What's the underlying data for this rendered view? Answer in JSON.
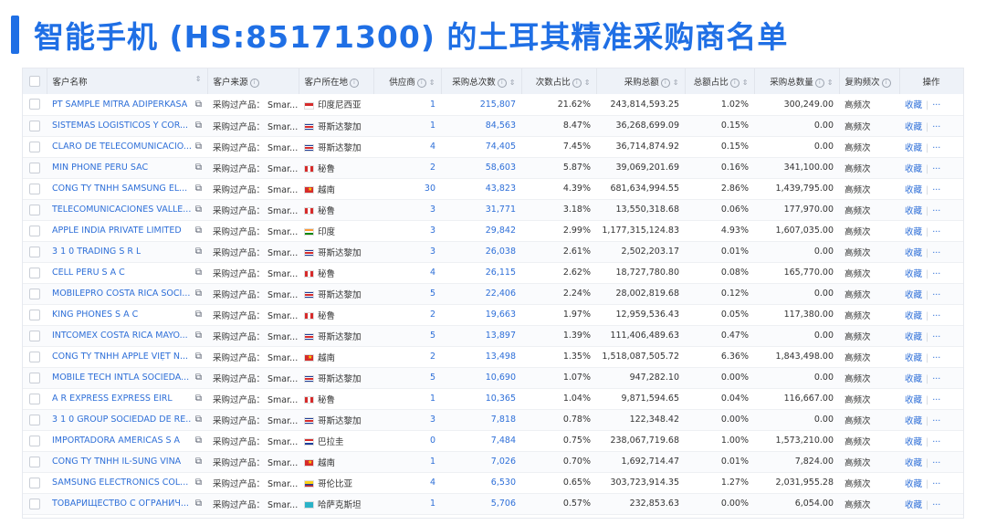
{
  "title": "智能手机 (HS:85171300) 的土耳其精准采购商名单",
  "columns": {
    "name": "客户名称",
    "source": "客户来源",
    "location": "客户所在地",
    "suppliers": "供应商",
    "purchase_count": "采购总次数",
    "count_share": "次数占比",
    "purchase_amount": "采购总额",
    "amount_share": "总额占比",
    "purchase_qty": "采购总数量",
    "repeat_freq": "复购频次",
    "actions": "操作"
  },
  "row_action_label": "收藏",
  "row_more_label": "···",
  "rows": [
    {
      "name": "PT SAMPLE MITRA ADIPERKASA",
      "source": "采购过产品： Smar...",
      "country": "印度尼西亚",
      "flag": "id",
      "suppliers": "1",
      "count": "215,807",
      "count_share": "21.62%",
      "amount": "243,814,593.25",
      "amount_share": "1.02%",
      "qty": "300,249.00",
      "freq": "高频次"
    },
    {
      "name": "SISTEMAS LOGISTICOS Y COR...",
      "source": "采购过产品： Smar...",
      "country": "哥斯达黎加",
      "flag": "cr",
      "suppliers": "1",
      "count": "84,563",
      "count_share": "8.47%",
      "amount": "36,268,699.09",
      "amount_share": "0.15%",
      "qty": "0.00",
      "freq": "高频次"
    },
    {
      "name": "CLARO DE TELECOMUNICACIO...",
      "source": "采购过产品： Smar...",
      "country": "哥斯达黎加",
      "flag": "cr",
      "suppliers": "4",
      "count": "74,405",
      "count_share": "7.45%",
      "amount": "36,714,874.92",
      "amount_share": "0.15%",
      "qty": "0.00",
      "freq": "高频次"
    },
    {
      "name": "MIN PHONE PERU SAC",
      "source": "采购过产品： Smar...",
      "country": "秘鲁",
      "flag": "pe",
      "suppliers": "2",
      "count": "58,603",
      "count_share": "5.87%",
      "amount": "39,069,201.69",
      "amount_share": "0.16%",
      "qty": "341,100.00",
      "freq": "高频次"
    },
    {
      "name": "CÔNG TY TNHH SAMSUNG EL...",
      "source": "采购过产品： Smar...",
      "country": "越南",
      "flag": "vn",
      "suppliers": "30",
      "count": "43,823",
      "count_share": "4.39%",
      "amount": "681,634,994.55",
      "amount_share": "2.86%",
      "qty": "1,439,795.00",
      "freq": "高频次"
    },
    {
      "name": "TELECOMUNICACIONES VALLE...",
      "source": "采购过产品： Smar...",
      "country": "秘鲁",
      "flag": "pe",
      "suppliers": "3",
      "count": "31,771",
      "count_share": "3.18%",
      "amount": "13,550,318.68",
      "amount_share": "0.06%",
      "qty": "177,970.00",
      "freq": "高频次"
    },
    {
      "name": "APPLE INDIA PRIVATE LIMITED",
      "source": "采购过产品： Smar...",
      "country": "印度",
      "flag": "in",
      "suppliers": "3",
      "count": "29,842",
      "count_share": "2.99%",
      "amount": "1,177,315,124.83",
      "amount_share": "4.93%",
      "qty": "1,607,035.00",
      "freq": "高频次"
    },
    {
      "name": "3 1 0 TRADING S R L",
      "source": "采购过产品： Smar...",
      "country": "哥斯达黎加",
      "flag": "cr",
      "suppliers": "3",
      "count": "26,038",
      "count_share": "2.61%",
      "amount": "2,502,203.17",
      "amount_share": "0.01%",
      "qty": "0.00",
      "freq": "高频次"
    },
    {
      "name": "CELL PERU S A C",
      "source": "采购过产品： Smar...",
      "country": "秘鲁",
      "flag": "pe",
      "suppliers": "4",
      "count": "26,115",
      "count_share": "2.62%",
      "amount": "18,727,780.80",
      "amount_share": "0.08%",
      "qty": "165,770.00",
      "freq": "高频次"
    },
    {
      "name": "MOBILEPRO COSTA RICA SOCI...",
      "source": "采购过产品： Smar...",
      "country": "哥斯达黎加",
      "flag": "cr",
      "suppliers": "5",
      "count": "22,406",
      "count_share": "2.24%",
      "amount": "28,002,819.68",
      "amount_share": "0.12%",
      "qty": "0.00",
      "freq": "高频次"
    },
    {
      "name": "KING PHONES S A C",
      "source": "采购过产品： Smar...",
      "country": "秘鲁",
      "flag": "pe",
      "suppliers": "2",
      "count": "19,663",
      "count_share": "1.97%",
      "amount": "12,959,536.43",
      "amount_share": "0.05%",
      "qty": "117,380.00",
      "freq": "高频次"
    },
    {
      "name": "INTCOMEX COSTA RICA MAYO...",
      "source": "采购过产品： Smar...",
      "country": "哥斯达黎加",
      "flag": "cr",
      "suppliers": "5",
      "count": "13,897",
      "count_share": "1.39%",
      "amount": "111,406,489.63",
      "amount_share": "0.47%",
      "qty": "0.00",
      "freq": "高频次"
    },
    {
      "name": "CÔNG TY TNHH APPLE VIỆT N...",
      "source": "采购过产品： Smar...",
      "country": "越南",
      "flag": "vn",
      "suppliers": "2",
      "count": "13,498",
      "count_share": "1.35%",
      "amount": "1,518,087,505.72",
      "amount_share": "6.36%",
      "qty": "1,843,498.00",
      "freq": "高频次"
    },
    {
      "name": "MOBILE TECH INTLA SOCIEDA...",
      "source": "采购过产品： Smar...",
      "country": "哥斯达黎加",
      "flag": "cr",
      "suppliers": "5",
      "count": "10,690",
      "count_share": "1.07%",
      "amount": "947,282.10",
      "amount_share": "0.00%",
      "qty": "0.00",
      "freq": "高频次"
    },
    {
      "name": "A R EXPRESS EXPRESS EIRL",
      "source": "采购过产品： Smar...",
      "country": "秘鲁",
      "flag": "pe",
      "suppliers": "1",
      "count": "10,365",
      "count_share": "1.04%",
      "amount": "9,871,594.65",
      "amount_share": "0.04%",
      "qty": "116,667.00",
      "freq": "高频次"
    },
    {
      "name": "3 1 0 GROUP SOCIEDAD DE RE...",
      "source": "采购过产品： Smar...",
      "country": "哥斯达黎加",
      "flag": "cr",
      "suppliers": "3",
      "count": "7,818",
      "count_share": "0.78%",
      "amount": "122,348.42",
      "amount_share": "0.00%",
      "qty": "0.00",
      "freq": "高频次"
    },
    {
      "name": "IMPORTADORA AMERICAS S A",
      "source": "采购过产品： Smar...",
      "country": "巴拉圭",
      "flag": "py",
      "suppliers": "0",
      "count": "7,484",
      "count_share": "0.75%",
      "amount": "238,067,719.68",
      "amount_share": "1.00%",
      "qty": "1,573,210.00",
      "freq": "高频次"
    },
    {
      "name": "CÔNG TY TNHH IL-SUNG VINA",
      "source": "采购过产品： Smar...",
      "country": "越南",
      "flag": "vn",
      "suppliers": "1",
      "count": "7,026",
      "count_share": "0.70%",
      "amount": "1,692,714.47",
      "amount_share": "0.01%",
      "qty": "7,824.00",
      "freq": "高频次"
    },
    {
      "name": "SAMSUNG ELECTRONICS COL...",
      "source": "采购过产品： Smar...",
      "country": "哥伦比亚",
      "flag": "co",
      "suppliers": "4",
      "count": "6,530",
      "count_share": "0.65%",
      "amount": "303,723,914.35",
      "amount_share": "1.27%",
      "qty": "2,031,955.28",
      "freq": "高频次"
    },
    {
      "name": "TOВАРИЩЕСТВО С ОГРАНИЧ...",
      "source": "采购过产品： Smar...",
      "country": "哈萨克斯坦",
      "flag": "kz",
      "suppliers": "1",
      "count": "5,706",
      "count_share": "0.57%",
      "amount": "232,853.63",
      "amount_share": "0.00%",
      "qty": "6,054.00",
      "freq": "高频次"
    }
  ]
}
